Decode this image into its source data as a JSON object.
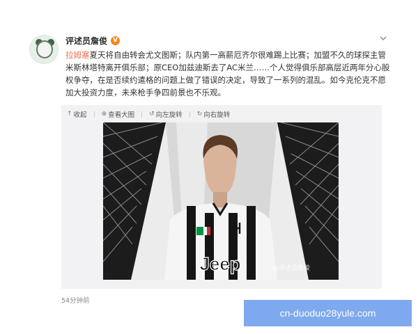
{
  "post": {
    "author": "评述员詹俊",
    "verified_badge": "V",
    "mention": "拉姆塞",
    "text_after_mention": "夏天将自由转会尤文图斯；队内第一高薪厄齐尔很难踢上比赛；加盟不久的球探主管米斯林塔特离开俱乐部；原CEO加兹迪斯去了AC米兰……个人觉得俱乐部高层近两年分心股权争夺，在是否续约遣格的问题上做了错误的决定，导致了一系列的混乱。如今克伦克不愿加大投资力度，未来枪手争四前景也不乐观。",
    "timestamp": "54分钟前"
  },
  "toolbar": {
    "collapse": "收起",
    "view_large": "查看大图",
    "rotate_left": "向左旋转",
    "rotate_right": "向右旋转",
    "icons": {
      "collapse": "collapse-icon",
      "view_large": "zoom-icon",
      "rotate_left": "rotate-left-icon",
      "rotate_right": "rotate-right-icon"
    }
  },
  "photo": {
    "shirt_sponsor": "Jeep",
    "image_watermark": "@评述员詹俊"
  },
  "overlay": {
    "site_watermark": "cn-duoduo28yule.com"
  },
  "colors": {
    "mention": "#eb7350",
    "verified_badge": "#f28a1c",
    "media_background": "#f2f2f5",
    "watermark_background": "#7fa9ee"
  }
}
